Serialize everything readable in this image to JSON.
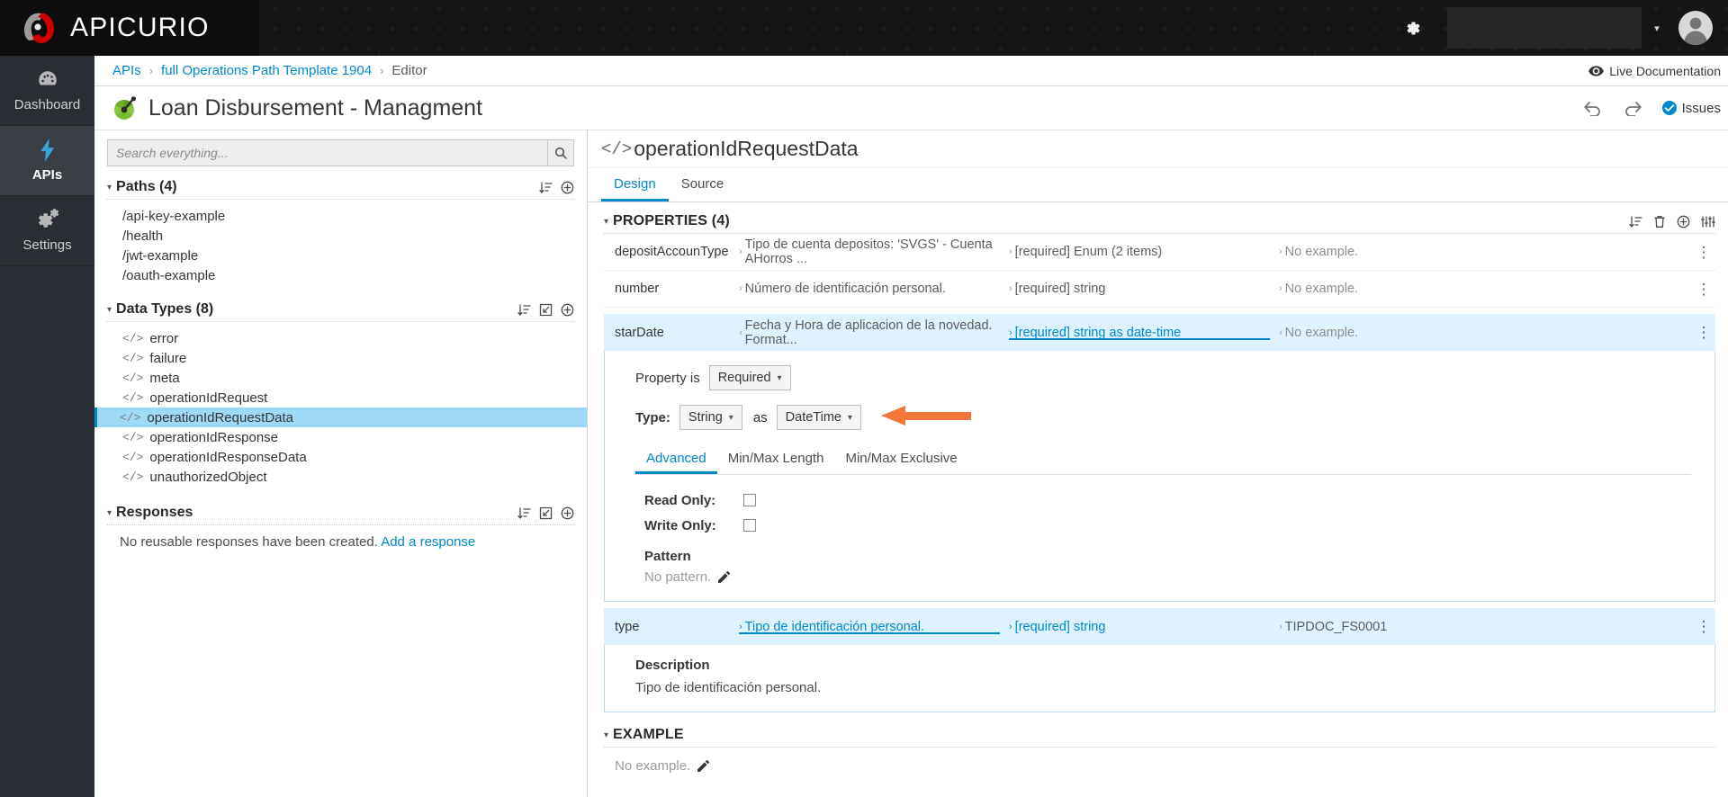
{
  "masthead": {
    "brand": "APICURIO",
    "gear_icon": "gear-icon",
    "caret_icon": "chevron-down-icon",
    "avatar_icon": "user-avatar-icon"
  },
  "rail": {
    "items": [
      {
        "label": "Dashboard",
        "icon": "dashboard-gauge-icon",
        "active": false
      },
      {
        "label": "APIs",
        "icon": "lightning-bolt-icon",
        "active": true
      },
      {
        "label": "Settings",
        "icon": "gears-icon",
        "active": false
      }
    ]
  },
  "breadcrumb": {
    "items": [
      {
        "label": "APIs",
        "link": true
      },
      {
        "label": "full Operations Path Template 1904",
        "link": true
      },
      {
        "label": "Editor",
        "link": false
      }
    ],
    "separator": "›",
    "live_documentation": "Live Documentation",
    "live_documentation_icon": "eye-icon"
  },
  "title": {
    "text": "Loan Disbursement - Managment",
    "icon": "api-design-icon",
    "undo_icon": "undo-arrow-icon",
    "redo_icon": "redo-arrow-icon",
    "issues_label": "Issues",
    "issues_icon": "check-circle-icon"
  },
  "left_panel": {
    "search_placeholder": "Search everything...",
    "search_value": "",
    "search_icon": "search-icon",
    "sections": [
      {
        "title": "Paths (4)",
        "tools": [
          "sort-icon",
          "add-circle-icon"
        ],
        "items": [
          {
            "label": "/api-key-example",
            "selected": false
          },
          {
            "label": "/health",
            "selected": false
          },
          {
            "label": "/jwt-example",
            "selected": false
          },
          {
            "label": "/oauth-example",
            "selected": false
          }
        ]
      },
      {
        "title": "Data Types (8)",
        "tools": [
          "sort-icon",
          "import-icon",
          "add-circle-icon"
        ],
        "items": [
          {
            "label": "error",
            "code": "</>",
            "selected": false
          },
          {
            "label": "failure",
            "code": "</>",
            "selected": false
          },
          {
            "label": "meta",
            "code": "</>",
            "selected": false
          },
          {
            "label": "operationIdRequest",
            "code": "</>",
            "selected": false
          },
          {
            "label": "operationIdRequestData",
            "code": "</>",
            "selected": true
          },
          {
            "label": "operationIdResponse",
            "code": "</>",
            "selected": false
          },
          {
            "label": "operationIdResponseData",
            "code": "</>",
            "selected": false
          },
          {
            "label": "unauthorizedObject",
            "code": "</>",
            "selected": false
          }
        ]
      },
      {
        "title": "Responses",
        "tools": [
          "sort-icon",
          "import-icon",
          "add-circle-icon"
        ],
        "empty_text": "No reusable responses have been created.",
        "empty_link": "Add a response",
        "items": []
      }
    ]
  },
  "main": {
    "heading_code": "</>",
    "heading": "operationIdRequestData",
    "tabs": [
      {
        "label": "Design",
        "active": true
      },
      {
        "label": "Source",
        "active": false
      }
    ],
    "properties_section": {
      "title": "PROPERTIES (4)",
      "tools": [
        "sort-icon",
        "trash-icon",
        "add-circle-icon",
        "columns-icon"
      ],
      "rows": [
        {
          "name": "depositAccounType",
          "description": "Tipo de cuenta depositos: 'SVGS' - Cuenta AHorros ...",
          "type": "[required] Enum (2 items)",
          "example": "No example.",
          "highlighted": false,
          "expanded": false
        },
        {
          "name": "number",
          "description": "Número de identificación personal.",
          "type": "[required] string",
          "example": "No example.",
          "highlighted": false,
          "expanded": false
        },
        {
          "name": "starDate",
          "description": "Fecha y Hora de aplicacion de la novedad. Format...",
          "type": "[required] string as date-time",
          "example": "No example.",
          "highlighted": true,
          "expanded": true
        },
        {
          "name": "type",
          "description": "Tipo de identificación personal.",
          "type": "[required] string",
          "example": "TIPDOC_FS0001",
          "highlighted": true,
          "expanded": true
        }
      ]
    },
    "property_editor": {
      "property_is_label": "Property is",
      "property_is_value": "Required",
      "type_label": "Type:",
      "type_value": "String",
      "as_label": "as",
      "format_value": "DateTime",
      "annotation_icon": "orange-arrow-pointer",
      "subtabs": [
        {
          "label": "Advanced",
          "active": true
        },
        {
          "label": "Min/Max Length",
          "active": false
        },
        {
          "label": "Min/Max Exclusive",
          "active": false
        }
      ],
      "read_only_label": "Read Only:",
      "read_only_checked": false,
      "write_only_label": "Write Only:",
      "write_only_checked": false,
      "pattern_heading": "Pattern",
      "pattern_value": "No pattern.",
      "pattern_edit_icon": "pencil-icon"
    },
    "type_detail": {
      "description_heading": "Description",
      "description_text": "Tipo de identificación personal."
    },
    "example_section": {
      "title": "EXAMPLE",
      "value": "No example.",
      "edit_icon": "pencil-icon"
    }
  },
  "colors": {
    "accent_blue": "#0088ce",
    "highlight_row": "#def3ff",
    "tree_selected": "#9ed9f5",
    "annotation_orange": "#f4763b",
    "masthead_dark": "#151515",
    "rail_dark": "#292e34"
  }
}
